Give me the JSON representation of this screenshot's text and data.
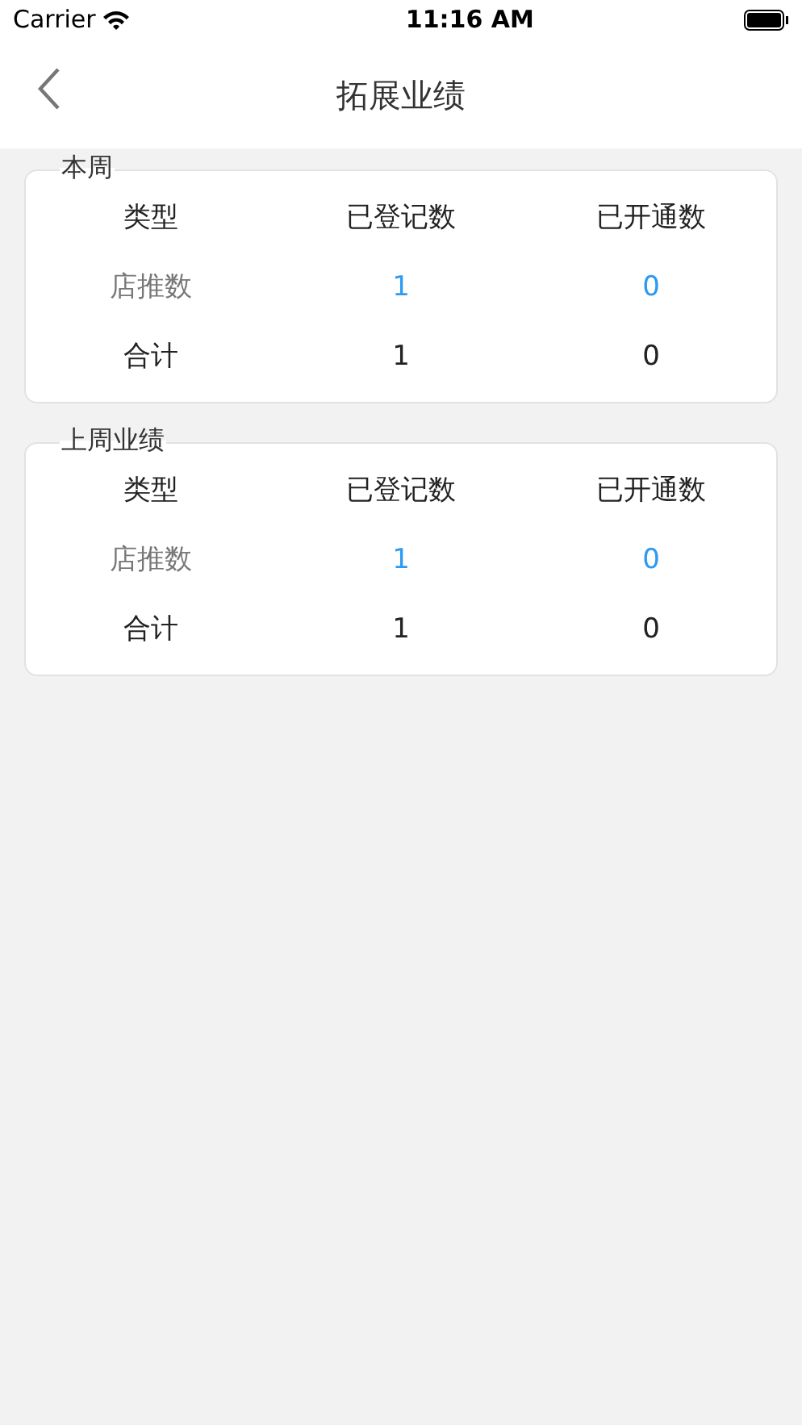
{
  "status_bar": {
    "carrier": "Carrier",
    "time": "11:16 AM"
  },
  "nav": {
    "title": "拓展业绩"
  },
  "sections": [
    {
      "title": "本周",
      "rows": [
        {
          "kind": "header",
          "cells": [
            "类型",
            "已登记数",
            "已开通数"
          ]
        },
        {
          "kind": "detail",
          "cells": [
            "店推数",
            "1",
            "0"
          ]
        },
        {
          "kind": "total",
          "cells": [
            "合计",
            "1",
            "0"
          ]
        }
      ]
    },
    {
      "title": "上周业绩",
      "rows": [
        {
          "kind": "header",
          "cells": [
            "类型",
            "已登记数",
            "已开通数"
          ]
        },
        {
          "kind": "detail",
          "cells": [
            "店推数",
            "1",
            "0"
          ]
        },
        {
          "kind": "total",
          "cells": [
            "合计",
            "1",
            "0"
          ]
        }
      ]
    }
  ]
}
